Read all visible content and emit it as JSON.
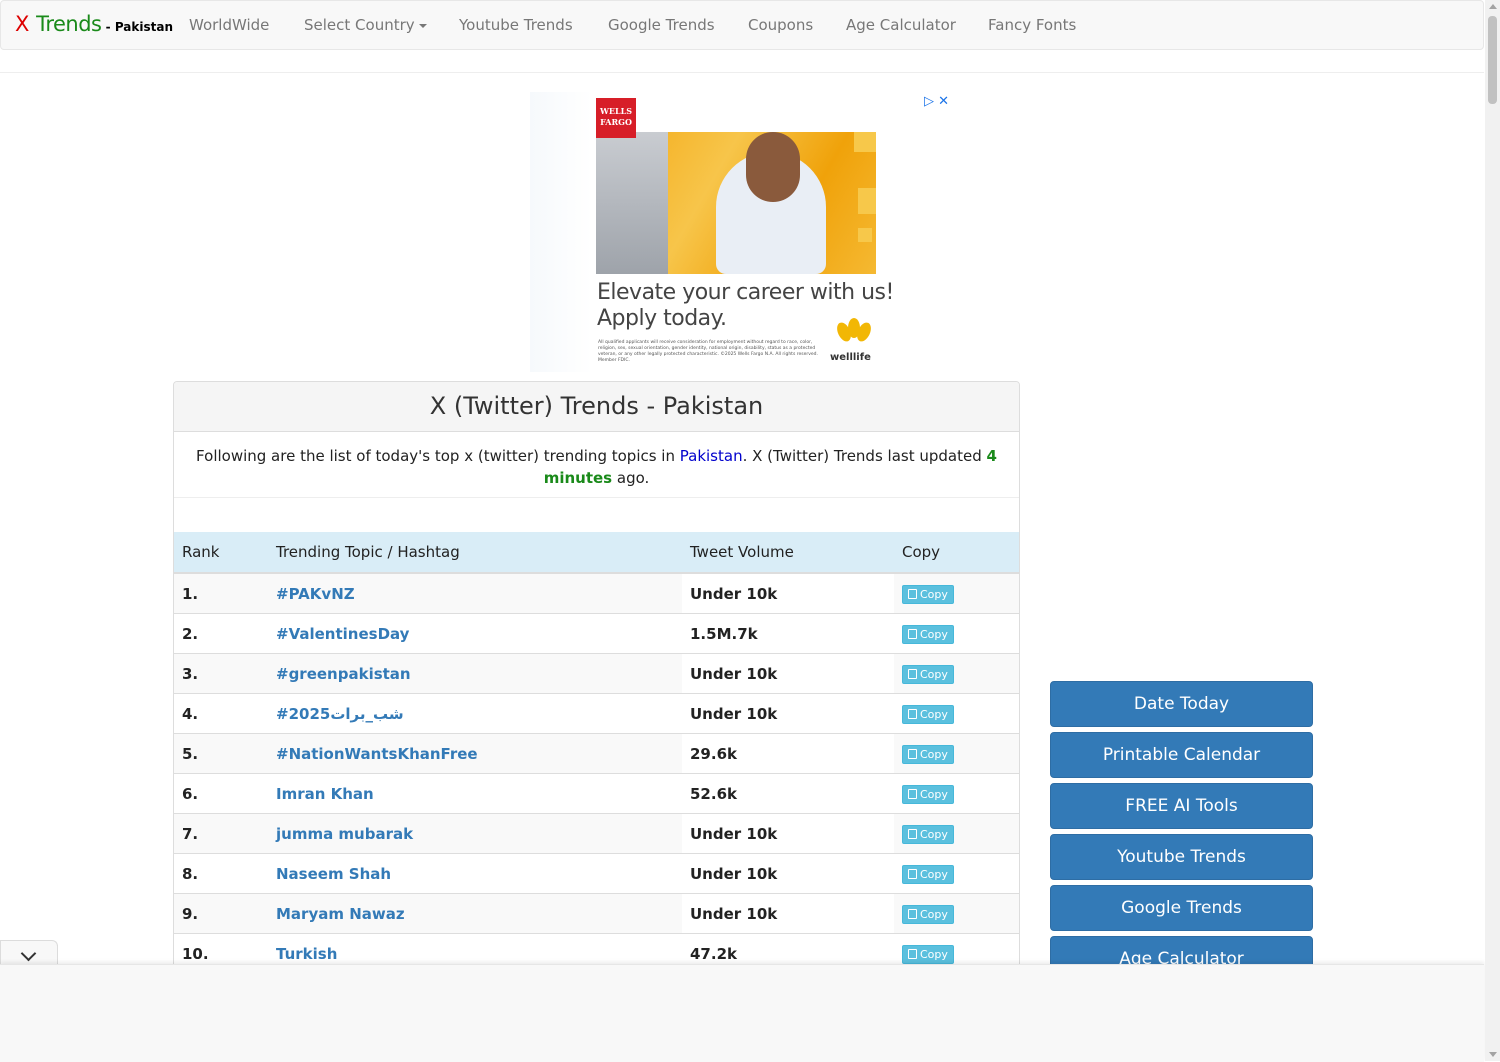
{
  "navbar": {
    "brand_x": "X",
    "brand_trends": "Trends",
    "brand_country": " - Pakistan",
    "items": [
      "WorldWide",
      "Select Country",
      "Youtube Trends",
      "Google Trends",
      "Coupons",
      "Age Calculator",
      "Fancy Fonts"
    ]
  },
  "ad": {
    "logo": "WELLS FARGO",
    "headline_1": "Elevate your career with us!",
    "headline_2": "Apply today.",
    "fine_print": "All qualified applicants will receive consideration for employment without regard to race, color, religion, sex, sexual orientation, gender identity, national origin, disability, status as a protected veteran, or any other legally protected characteristic. ©2025 Wells Fargo N.A. All rights reserved. Member FDIC.",
    "welllife": "welllife",
    "icons": [
      "adchoices-icon",
      "close-icon"
    ]
  },
  "panel": {
    "title": "X (Twitter) Trends - Pakistan",
    "intro_before": "Following are the list of today's top x (twitter) trending topics in ",
    "intro_country": "Pakistan",
    "intro_middle": ". X (Twitter) Trends last updated ",
    "intro_updated": "4 minutes",
    "intro_after": " ago."
  },
  "table": {
    "headers": [
      "Rank",
      "Trending Topic / Hashtag",
      "Tweet Volume",
      "Copy"
    ],
    "rows": [
      {
        "rank": "1.",
        "topic": "#PAKvNZ",
        "volume": "Under 10k",
        "copy": "Copy"
      },
      {
        "rank": "2.",
        "topic": "#ValentinesDay",
        "volume": "1.5M.7k",
        "copy": "Copy"
      },
      {
        "rank": "3.",
        "topic": "#greenpakistan",
        "volume": "Under 10k",
        "copy": "Copy"
      },
      {
        "rank": "4.",
        "topic": "#شب_برات2025",
        "volume": "Under 10k",
        "copy": "Copy"
      },
      {
        "rank": "5.",
        "topic": "#NationWantsKhanFree",
        "volume": "29.6k",
        "copy": "Copy"
      },
      {
        "rank": "6.",
        "topic": "Imran Khan",
        "volume": "52.6k",
        "copy": "Copy"
      },
      {
        "rank": "7.",
        "topic": "jumma mubarak",
        "volume": "Under 10k",
        "copy": "Copy"
      },
      {
        "rank": "8.",
        "topic": "Naseem Shah",
        "volume": "Under 10k",
        "copy": "Copy"
      },
      {
        "rank": "9.",
        "topic": "Maryam Nawaz",
        "volume": "Under 10k",
        "copy": "Copy"
      },
      {
        "rank": "10.",
        "topic": "Turkish",
        "volume": "47.2k",
        "copy": "Copy"
      }
    ]
  },
  "sidebar": {
    "buttons": [
      "Date Today",
      "Printable Calendar",
      "FREE AI Tools",
      "Youtube Trends",
      "Google Trends",
      "Age Calculator"
    ]
  },
  "colors": {
    "brand_x": "#dd0000",
    "brand_trends": "#1a8a1a",
    "link": "#337ab7",
    "table_header_bg": "#d9edf7",
    "copy_button": "#5bc0de",
    "sidebar_button": "#337ab7"
  }
}
